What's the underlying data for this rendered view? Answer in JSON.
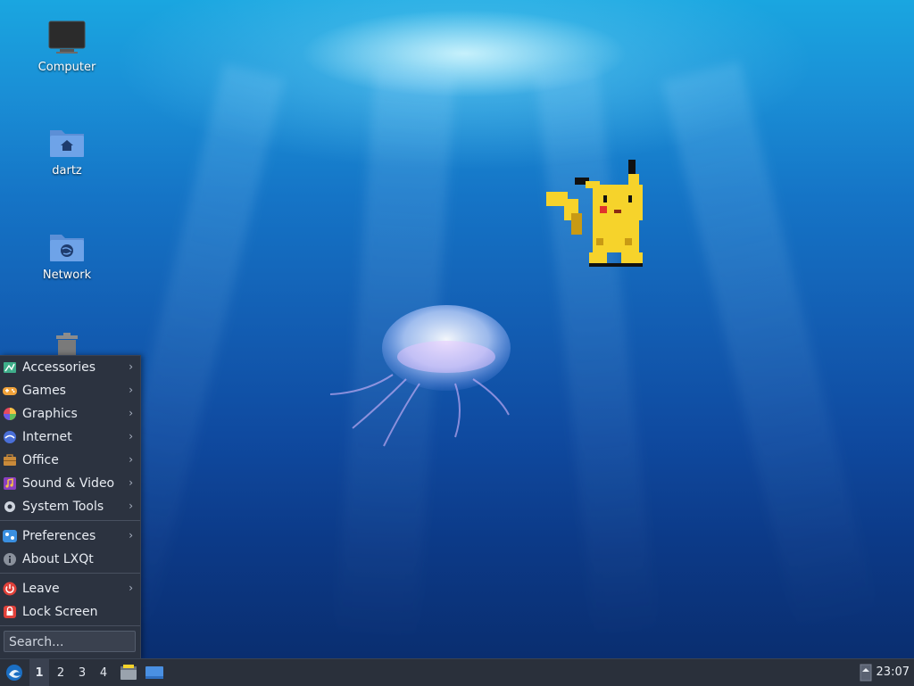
{
  "desktop": {
    "icons": [
      {
        "label": "Computer",
        "icon": "computer-icon"
      },
      {
        "label": "dartz",
        "icon": "home-folder-icon"
      },
      {
        "label": "Network",
        "icon": "network-folder-icon"
      },
      {
        "label": "",
        "icon": "trash-icon"
      }
    ]
  },
  "menu": {
    "items": [
      {
        "label": "Accessories",
        "icon": "accessories-icon",
        "submenu": true
      },
      {
        "label": "Games",
        "icon": "games-icon",
        "submenu": true
      },
      {
        "label": "Graphics",
        "icon": "graphics-icon",
        "submenu": true
      },
      {
        "label": "Internet",
        "icon": "internet-icon",
        "submenu": true
      },
      {
        "label": "Office",
        "icon": "office-icon",
        "submenu": true
      },
      {
        "label": "Sound & Video",
        "icon": "sound-video-icon",
        "submenu": true
      },
      {
        "label": "System Tools",
        "icon": "system-tools-icon",
        "submenu": true
      },
      {
        "label": "Preferences",
        "icon": "preferences-icon",
        "submenu": true
      },
      {
        "label": "About LXQt",
        "icon": "info-icon",
        "submenu": false
      },
      {
        "label": "Leave",
        "icon": "power-icon",
        "submenu": true
      },
      {
        "label": "Lock Screen",
        "icon": "lock-icon",
        "submenu": false
      }
    ],
    "search_placeholder": "Search...",
    "arrow": "›"
  },
  "taskbar": {
    "workspaces": [
      "1",
      "2",
      "3",
      "4"
    ],
    "active_workspace": "1",
    "clock": "23:07"
  },
  "colors": {
    "menu_bg": "#2c3340",
    "taskbar_bg": "#2a303b",
    "desktop_top": "#1aa6e0",
    "desktop_bottom": "#0a2e70"
  }
}
